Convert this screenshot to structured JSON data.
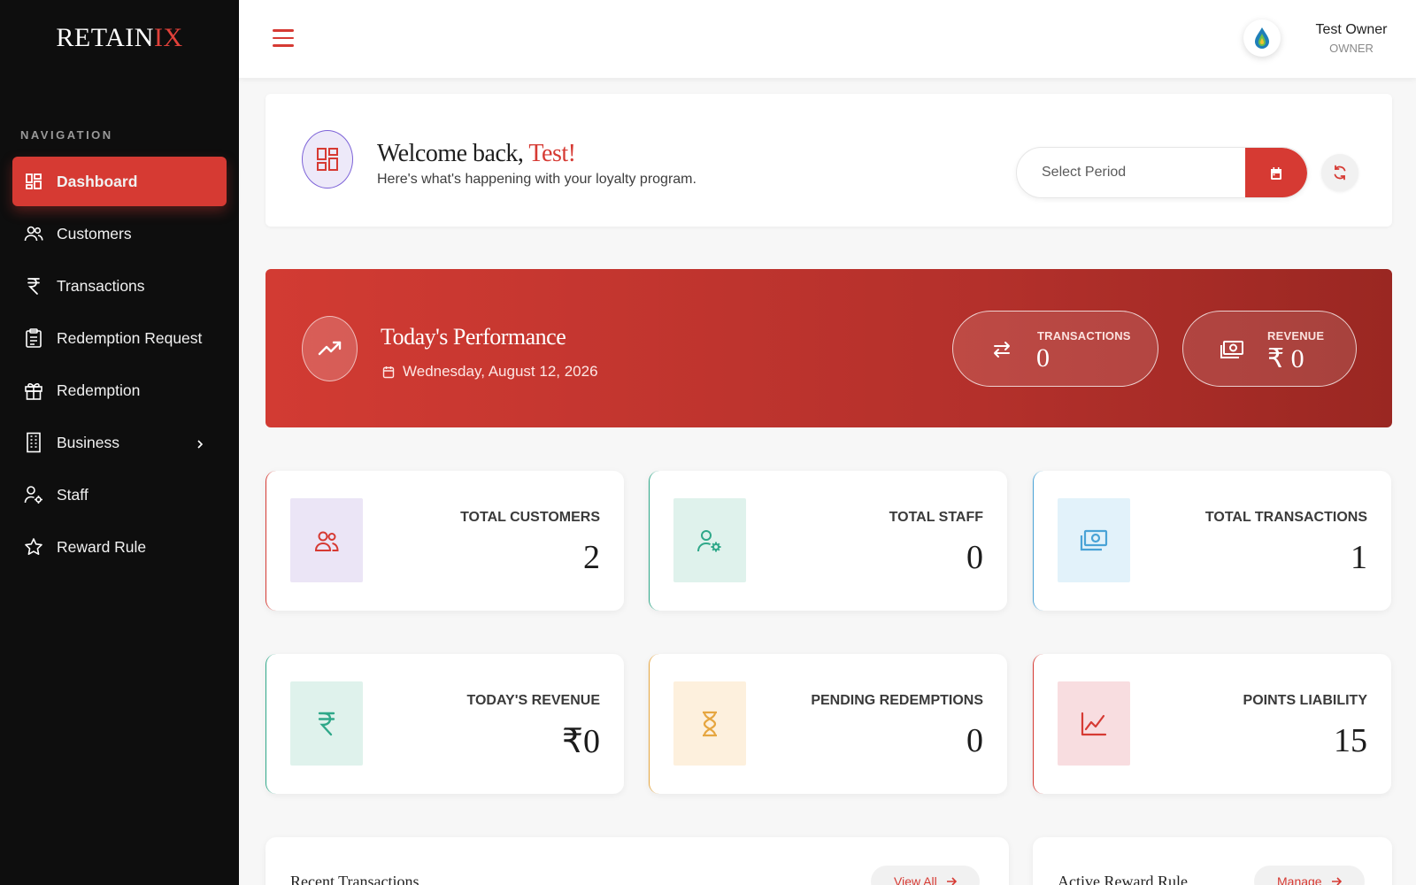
{
  "app": {
    "logo_main": "RETAIN",
    "logo_accent": "IX"
  },
  "sidebar": {
    "heading": "NAVIGATION",
    "items": [
      {
        "label": "Dashboard",
        "icon": "dashboard-icon",
        "active": true
      },
      {
        "label": "Customers",
        "icon": "users-icon"
      },
      {
        "label": "Transactions",
        "icon": "rupee-icon"
      },
      {
        "label": "Redemption Request",
        "icon": "clipboard-icon"
      },
      {
        "label": "Redemption",
        "icon": "gift-icon"
      },
      {
        "label": "Business",
        "icon": "building-icon",
        "has_submenu": true
      },
      {
        "label": "Staff",
        "icon": "user-gear-icon"
      },
      {
        "label": "Reward Rule",
        "icon": "star-icon"
      }
    ]
  },
  "topbar": {
    "user_name": "Test Owner",
    "user_role": "OWNER"
  },
  "welcome": {
    "greeting": "Welcome back,",
    "name": "Test",
    "exclaim": "!",
    "subtitle": "Here's what's happening with your loyalty program.",
    "period_placeholder": "Select Period"
  },
  "performance": {
    "title": "Today's Performance",
    "date": "Wednesday, August 12, 2026",
    "transactions_label": "TRANSACTIONS",
    "transactions_value": "0",
    "revenue_label": "REVENUE",
    "revenue_value": "₹ 0"
  },
  "stats": [
    {
      "label": "TOTAL CUSTOMERS",
      "value": "2",
      "icon": "users-icon",
      "color": "#d63a33",
      "bg": "#ebe5f6"
    },
    {
      "label": "TOTAL STAFF",
      "value": "0",
      "icon": "user-gear-icon",
      "color": "#2fa889",
      "bg": "#dff2ec"
    },
    {
      "label": "TOTAL TRANSACTIONS",
      "value": "1",
      "icon": "money-icon",
      "color": "#4aa3d6",
      "bg": "#e2f2fa"
    },
    {
      "label": "TODAY'S REVENUE",
      "value": "₹0",
      "icon": "rupee-icon",
      "color": "#2fa889",
      "bg": "#dff2ec"
    },
    {
      "label": "PENDING REDEMPTIONS",
      "value": "0",
      "icon": "hourglass-icon",
      "color": "#e6a640",
      "bg": "#fdf0dd"
    },
    {
      "label": "POINTS LIABILITY",
      "value": "15",
      "icon": "chart-line-icon",
      "color": "#d63a33",
      "bg": "#f8dde0"
    }
  ],
  "bottom": {
    "recent_title": "Recent Transactions",
    "recent_button": "View All",
    "reward_title": "Active Reward Rule",
    "reward_button": "Manage"
  },
  "colors": {
    "accent": "#d63a33",
    "sidebar_bg": "#0e0e0e"
  }
}
